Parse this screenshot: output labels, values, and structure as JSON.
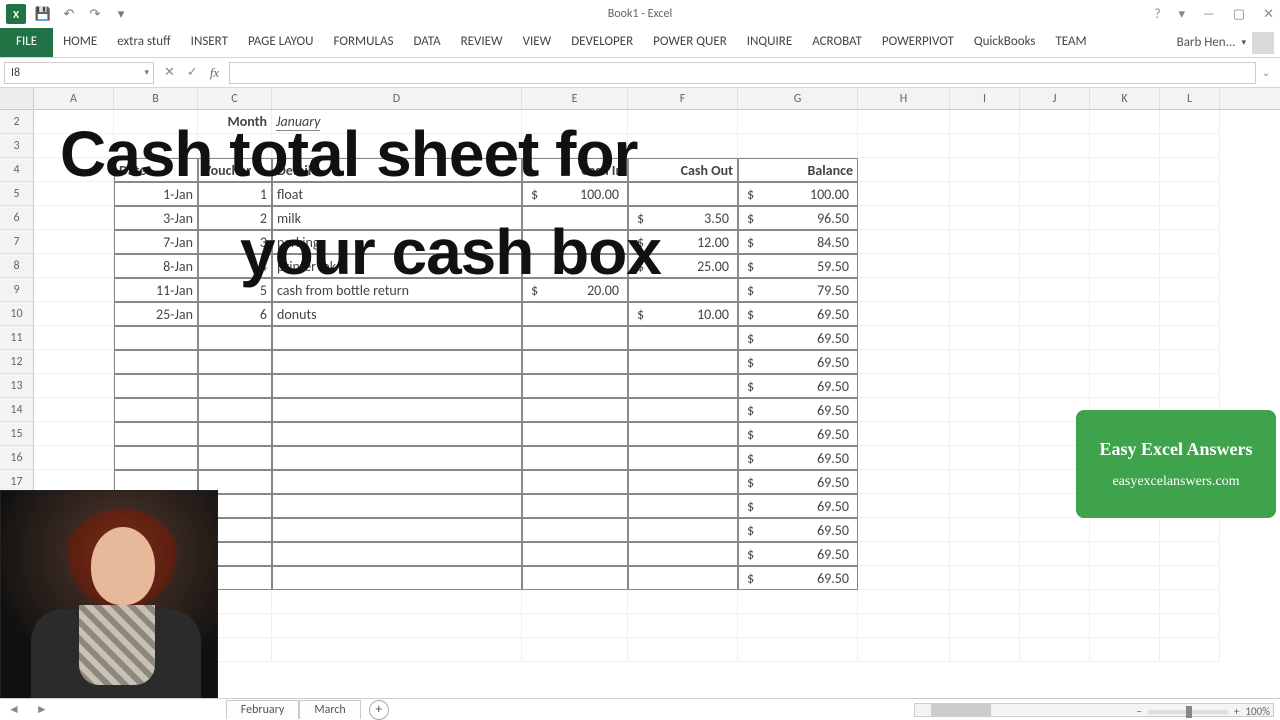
{
  "window": {
    "title": "Book1 - Excel",
    "help_icon": "?",
    "ribbon_mode_icon": "▾",
    "min_icon": "—",
    "max_icon": "▢",
    "close_icon": "✕"
  },
  "qat": {
    "save": "💾",
    "undo": "↶",
    "redo": "↷",
    "dropdown": "▾"
  },
  "tabs": [
    "HOME",
    "extra stuff",
    "INSERT",
    "PAGE LAYOU",
    "FORMULAS",
    "DATA",
    "REVIEW",
    "VIEW",
    "DEVELOPER",
    "POWER QUER",
    "INQUIRE",
    "ACROBAT",
    "POWERPIVOT",
    "QuickBooks",
    "TEAM"
  ],
  "file_tab": "FILE",
  "user_name": "Barb Hen...",
  "name_box": "I8",
  "fx": {
    "cancel": "✕",
    "enter": "✓",
    "label": "fx"
  },
  "columns": [
    "A",
    "B",
    "C",
    "D",
    "E",
    "F",
    "G",
    "H",
    "I",
    "J",
    "K",
    "L"
  ],
  "sheet": {
    "month_label": "Month",
    "month_value": "January",
    "hdr": {
      "date": "Date",
      "voucher": "Voucher",
      "detail": "Detail",
      "cash_in": "Cash In",
      "cash_out": "Cash Out",
      "balance": "Balance"
    },
    "rows": [
      {
        "date": "1-Jan",
        "v": "1",
        "detail": "float",
        "in": "100.00",
        "out": "",
        "bal": "100.00"
      },
      {
        "date": "3-Jan",
        "v": "2",
        "detail": "milk",
        "in": "",
        "out": "3.50",
        "bal": "96.50"
      },
      {
        "date": "7-Jan",
        "v": "3",
        "detail": "parking",
        "in": "",
        "out": "12.00",
        "bal": "84.50"
      },
      {
        "date": "8-Jan",
        "v": "4",
        "detail": "printer ink",
        "in": "",
        "out": "25.00",
        "bal": "59.50"
      },
      {
        "date": "11-Jan",
        "v": "5",
        "detail": "cash from bottle return",
        "in": "20.00",
        "out": "",
        "bal": "79.50"
      },
      {
        "date": "25-Jan",
        "v": "6",
        "detail": "donuts",
        "in": "",
        "out": "10.00",
        "bal": "69.50"
      }
    ],
    "repeat_balance": "69.50",
    "repeat_count": 11
  },
  "overlay": {
    "line1": "Cash total sheet for",
    "line2": "your cash box"
  },
  "promo": {
    "title": "Easy Excel Answers",
    "url": "easyexcelanswers.com"
  },
  "sheet_tabs": [
    "February",
    "March"
  ],
  "new_sheet": "+",
  "zoom_pct": "100%"
}
